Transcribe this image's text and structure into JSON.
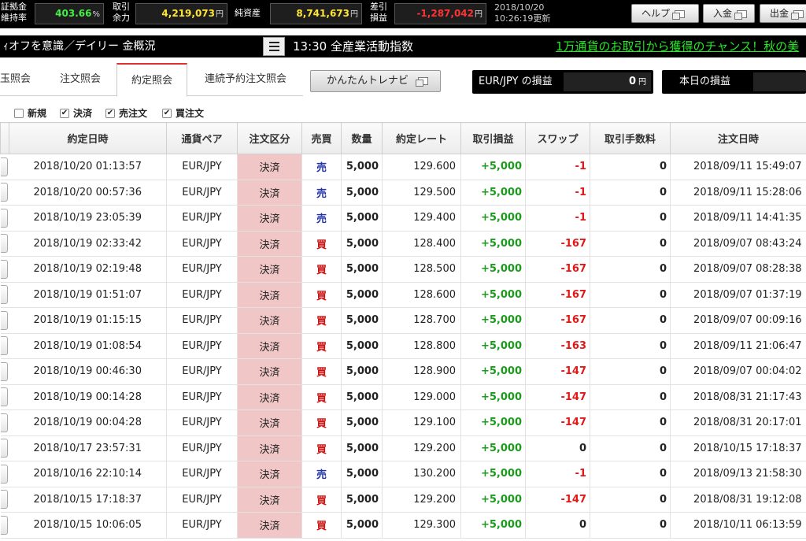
{
  "topbar": {
    "margin_label_1": "証拠金",
    "margin_label_2": "維持率",
    "margin_value": "403.66",
    "margin_unit": "%",
    "trade_label_1": "取引",
    "trade_label_2": "余力",
    "trade_value": "4,219,073",
    "net_label": "純資産",
    "net_value": "8,741,673",
    "diff_label_1": "差引",
    "diff_label_2": "損益",
    "diff_value": "-1,287,042",
    "yen": "円",
    "updated_date": "2018/10/20",
    "updated_time": "10:26:19更新",
    "help_button": "ヘルプ",
    "deposit_button": "入金",
    "withdraw_button": "出金"
  },
  "ticker": {
    "left_text": "ｨオフを意識／デイリー 金概況",
    "news_text": "13:30 全産業活動指数",
    "promo_text": "1万通貨のお取引から獲得のチャンス！秋の美"
  },
  "tabs": {
    "items": [
      {
        "label": "玉照会",
        "active": false
      },
      {
        "label": "注文照会",
        "active": false
      },
      {
        "label": "約定照会",
        "active": true
      },
      {
        "label": "連続予約注文照会",
        "active": false
      }
    ],
    "trainer_button": "かんたんトレナビ",
    "pair_pl_label": "EUR/JPY の損益",
    "pair_pl_value": "0",
    "today_pl_label": "本日の損益",
    "yen": "円"
  },
  "filters": [
    {
      "label": "新規",
      "checked": false
    },
    {
      "label": "決済",
      "checked": true
    },
    {
      "label": "売注文",
      "checked": true
    },
    {
      "label": "買注文",
      "checked": true
    }
  ],
  "columns": [
    "約定日時",
    "通貨ペア",
    "注文区分",
    "売買",
    "数量",
    "約定レート",
    "取引損益",
    "スワップ",
    "取引手数料",
    "注文日時"
  ],
  "rows": [
    [
      "2018/10/20 01:13:57",
      "EUR/JPY",
      "決済",
      "売",
      "5,000",
      "129.600",
      "+5,000",
      "-1",
      "0",
      "2018/09/11 15:49:07"
    ],
    [
      "2018/10/20 00:57:36",
      "EUR/JPY",
      "決済",
      "売",
      "5,000",
      "129.500",
      "+5,000",
      "-1",
      "0",
      "2018/09/11 15:28:06"
    ],
    [
      "2018/10/19 23:05:39",
      "EUR/JPY",
      "決済",
      "売",
      "5,000",
      "129.400",
      "+5,000",
      "-1",
      "0",
      "2018/09/11 14:41:35"
    ],
    [
      "2018/10/19 02:33:42",
      "EUR/JPY",
      "決済",
      "買",
      "5,000",
      "128.400",
      "+5,000",
      "-167",
      "0",
      "2018/09/07 08:43:24"
    ],
    [
      "2018/10/19 02:19:48",
      "EUR/JPY",
      "決済",
      "買",
      "5,000",
      "128.500",
      "+5,000",
      "-167",
      "0",
      "2018/09/07 08:28:38"
    ],
    [
      "2018/10/19 01:51:07",
      "EUR/JPY",
      "決済",
      "買",
      "5,000",
      "128.600",
      "+5,000",
      "-167",
      "0",
      "2018/09/07 01:37:19"
    ],
    [
      "2018/10/19 01:15:15",
      "EUR/JPY",
      "決済",
      "買",
      "5,000",
      "128.700",
      "+5,000",
      "-167",
      "0",
      "2018/09/07 00:09:16"
    ],
    [
      "2018/10/19 01:08:54",
      "EUR/JPY",
      "決済",
      "買",
      "5,000",
      "128.800",
      "+5,000",
      "-163",
      "0",
      "2018/09/11 21:06:47"
    ],
    [
      "2018/10/19 00:46:30",
      "EUR/JPY",
      "決済",
      "買",
      "5,000",
      "128.900",
      "+5,000",
      "-147",
      "0",
      "2018/09/07 00:04:02"
    ],
    [
      "2018/10/19 00:14:28",
      "EUR/JPY",
      "決済",
      "買",
      "5,000",
      "129.000",
      "+5,000",
      "-147",
      "0",
      "2018/08/31 21:17:43"
    ],
    [
      "2018/10/19 00:04:28",
      "EUR/JPY",
      "決済",
      "買",
      "5,000",
      "129.100",
      "+5,000",
      "-147",
      "0",
      "2018/08/31 20:17:01"
    ],
    [
      "2018/10/17 23:57:31",
      "EUR/JPY",
      "決済",
      "買",
      "5,000",
      "129.200",
      "+5,000",
      "0",
      "0",
      "2018/10/15 17:18:37"
    ],
    [
      "2018/10/16 22:10:14",
      "EUR/JPY",
      "決済",
      "売",
      "5,000",
      "130.200",
      "+5,000",
      "-1",
      "0",
      "2018/09/13 21:58:30"
    ],
    [
      "2018/10/15 17:18:37",
      "EUR/JPY",
      "決済",
      "買",
      "5,000",
      "129.200",
      "+5,000",
      "-147",
      "0",
      "2018/08/31 19:12:08"
    ],
    [
      "2018/10/15 10:06:05",
      "EUR/JPY",
      "決済",
      "買",
      "5,000",
      "129.300",
      "+5,000",
      "0",
      "0",
      "2018/10/11 06:13:59"
    ]
  ]
}
